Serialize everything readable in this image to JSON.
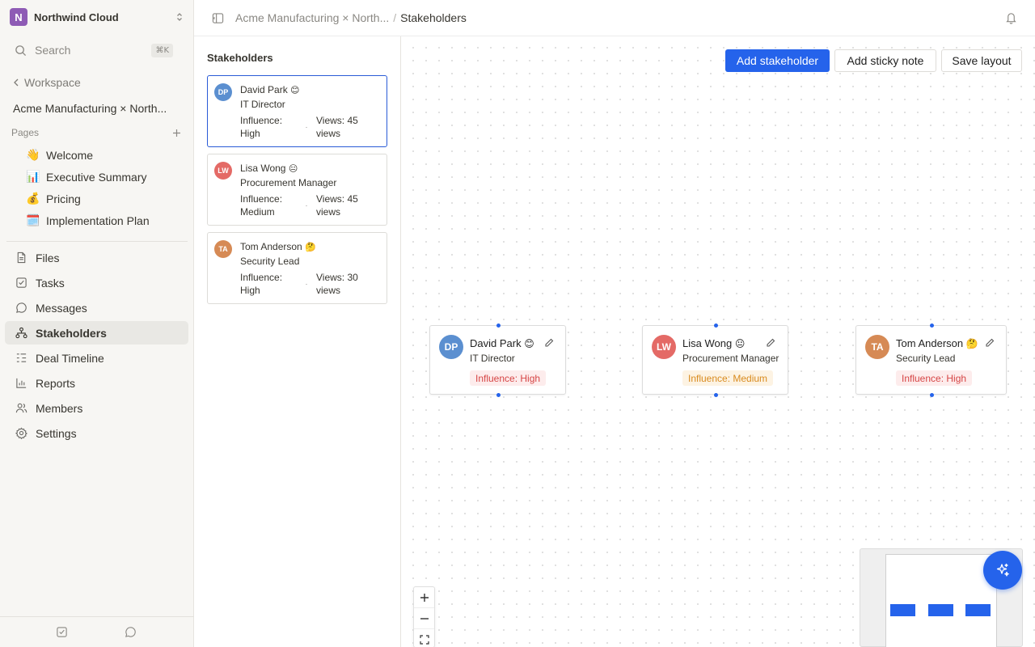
{
  "workspace": {
    "initial": "N",
    "name": "Northwind Cloud",
    "search_label": "Search",
    "search_shortcut": "⌘K",
    "back_label": "Workspace",
    "project_title": "Acme Manufacturing × North...",
    "pages_header": "Pages"
  },
  "pages": [
    {
      "emoji": "👋",
      "label": "Welcome"
    },
    {
      "emoji": "📊",
      "label": "Executive Summary"
    },
    {
      "emoji": "💰",
      "label": "Pricing"
    },
    {
      "emoji": "🗓️",
      "label": "Implementation Plan"
    }
  ],
  "nav": [
    {
      "icon": "file-icon",
      "label": "Files"
    },
    {
      "icon": "checkbox-icon",
      "label": "Tasks"
    },
    {
      "icon": "message-icon",
      "label": "Messages"
    },
    {
      "icon": "org-chart-icon",
      "label": "Stakeholders",
      "active": true
    },
    {
      "icon": "timeline-icon",
      "label": "Deal Timeline"
    },
    {
      "icon": "bar-chart-icon",
      "label": "Reports"
    },
    {
      "icon": "users-icon",
      "label": "Members"
    },
    {
      "icon": "gear-icon",
      "label": "Settings"
    }
  ],
  "header": {
    "breadcrumb_parent": "Acme Manufacturing × North...",
    "breadcrumb_separator": "/",
    "breadcrumb_current": "Stakeholders"
  },
  "list": {
    "title": "Stakeholders",
    "items": [
      {
        "initials": "DP",
        "name": "David Park",
        "emoji": "😊",
        "role": "IT Director",
        "influence": "Influence: High",
        "views": "Views: 45 views",
        "dot": "·"
      },
      {
        "initials": "LW",
        "name": "Lisa Wong",
        "emoji": "😐",
        "role": "Procurement Manager",
        "influence": "Influence: Medium",
        "views": "Views: 45 views",
        "dot": "·"
      },
      {
        "initials": "TA",
        "name": "Tom Anderson",
        "emoji": "🤔",
        "role": "Security Lead",
        "influence": "Influence: High",
        "views": "Views: 30 views",
        "dot": "·"
      }
    ]
  },
  "toolbar": {
    "add_stakeholder": "Add stakeholder",
    "add_sticky_note": "Add sticky note",
    "save_layout": "Save layout"
  },
  "nodes": [
    {
      "initials": "DP",
      "name": "David Park",
      "emoji": "😊",
      "role": "IT Director",
      "influence": "Influence: High",
      "level": "high"
    },
    {
      "initials": "LW",
      "name": "Lisa Wong",
      "emoji": "😐",
      "role": "Procurement Manager",
      "influence": "Influence: Medium",
      "level": "medium"
    },
    {
      "initials": "TA",
      "name": "Tom Anderson",
      "emoji": "🤔",
      "role": "Security Lead",
      "influence": "Influence: High",
      "level": "high"
    }
  ],
  "colors": {
    "accent": "#2563eb",
    "avatar_dp": "#5b8fd0",
    "avatar_lw": "#e46a66",
    "avatar_ta": "#d68a55",
    "influence_high_bg": "#fdecec",
    "influence_high_text": "#d64545",
    "influence_medium_bg": "#fdf3e3",
    "influence_medium_text": "#d98b1f",
    "workspace_logo": "#8e5bb5"
  }
}
